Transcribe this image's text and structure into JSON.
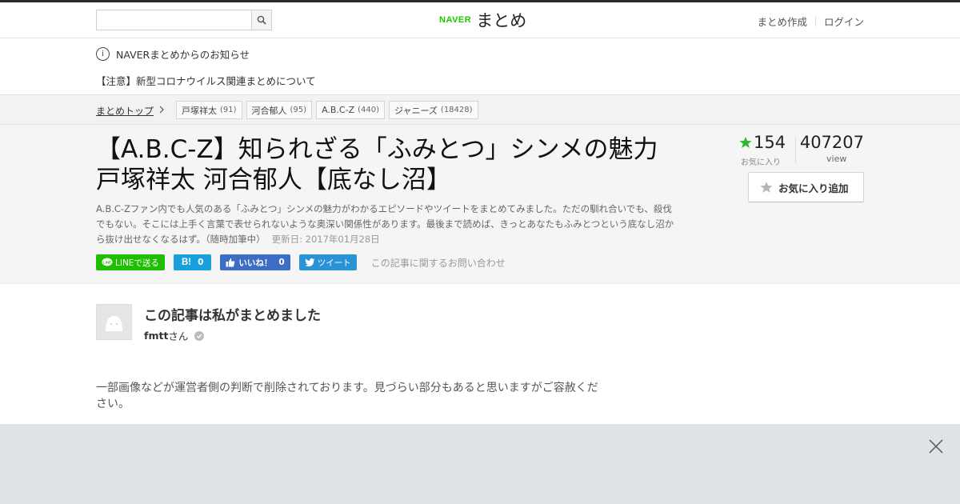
{
  "header": {
    "search_placeholder": "",
    "logo_naver": "NAVER",
    "logo_matome": "まとめ",
    "links": [
      "まとめ作成",
      "ログイン"
    ]
  },
  "notice": {
    "heading": "NAVERまとめからのお知らせ",
    "link_text": "【注意】新型コロナウイルス関連まとめについて"
  },
  "breadcrumb": {
    "top_label": "まとめトップ",
    "tags": [
      {
        "name": "戸塚祥太",
        "count": "(91)"
      },
      {
        "name": "河合郁人",
        "count": "(95)"
      },
      {
        "name": "A.B.C-Z",
        "count": "(440)"
      },
      {
        "name": "ジャニーズ",
        "count": "(18428)"
      }
    ]
  },
  "article": {
    "title": "【A.B.C-Z】知られざる「ふみとつ」シンメの魅力　戸塚祥太 河合郁人【底なし沼】",
    "description": "A.B.C-Zファン内でも人気のある「ふみとつ」シンメの魅力がわかるエピソードやツイートをまとめてみました。ただの馴れ合いでも、殺伐でもない。そこには上手く言葉で表せられないような奥深い関係性があります。最後まで読めば、きっとあなたもふみとつという底なし沼から抜け出せなくなるはず。（随時加筆中）",
    "updated": "更新日: 2017年01月28日",
    "share": {
      "line": "LINEで送る",
      "hatena_icon": "B!",
      "hatena_count": "0",
      "fb_like": "いいね！",
      "fb_count": "0",
      "tweet": "ツイート",
      "contact": "この記事に関するお問い合わせ"
    },
    "stats": {
      "favorites": "154",
      "favorites_label": "お気に入り",
      "views": "407207",
      "views_label": "view"
    },
    "fav_button": "お気に入り追加"
  },
  "author": {
    "heading": "この記事は私がまとめました",
    "name": "fmtt",
    "suffix": "さん"
  },
  "body": {
    "text": "一部画像などが運営者側の判断で削除されております。見づらい部分もあると思いますがご容赦ください。"
  },
  "colors": {
    "naver_green": "#1ec800",
    "line_green": "#1dbf00",
    "hatena_blue": "#1a9fdd",
    "facebook_blue": "#3b6ec4",
    "twitter_blue": "#2a93d8",
    "star_green": "#2fb52f",
    "ad_background": "#dfe3e7"
  },
  "icons": [
    "search-icon",
    "info-icon",
    "chevron-right-icon",
    "line-icon",
    "hatena-icon",
    "thumbs-up-icon",
    "twitter-bird-icon",
    "star-icon",
    "avatar-icon",
    "verified-check-icon",
    "close-icon"
  ]
}
